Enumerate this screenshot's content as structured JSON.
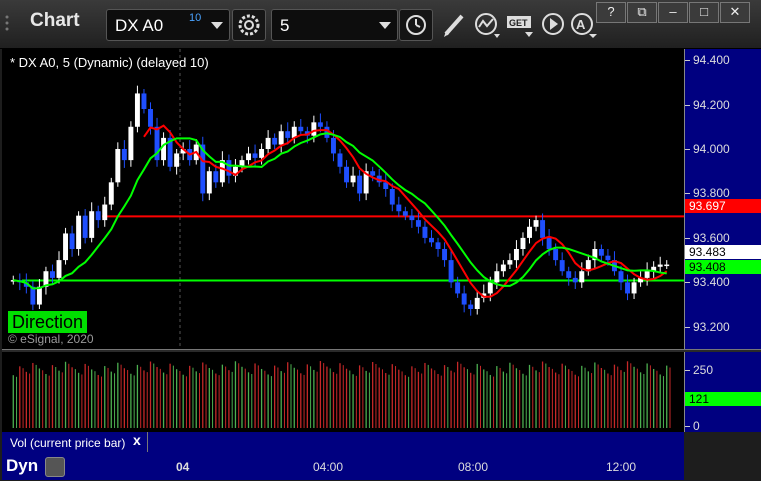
{
  "title_bar": {
    "app_title": "Chart",
    "symbol": "DX A0",
    "symbol_delay": "10",
    "interval": "5"
  },
  "window_buttons": [
    "?",
    "⧉",
    "–",
    "□",
    "✕"
  ],
  "chart": {
    "title": "* DX A0, 5 (Dynamic) (delayed 10)",
    "copyright": "© eSignal, 2020",
    "direction_label": "Direction",
    "price_ticks": [
      "94.400",
      "94.200",
      "94.000",
      "93.800",
      "93.600",
      "93.400",
      "93.200"
    ],
    "tags": [
      {
        "text": "93.697",
        "bg": "#ff0000",
        "fg": "#ffffff"
      },
      {
        "text": "93.483",
        "bg": "#ffffff",
        "fg": "#000000"
      },
      {
        "text": "93.408",
        "bg": "#00ff00",
        "fg": "#000000"
      }
    ],
    "colors": {
      "up_bar": "#ffffff",
      "down_bar": "#1f4fff",
      "red_line": "#ff0000",
      "green_line": "#00ff00",
      "vol_up": "#4caf50",
      "vol_down": "#c62828"
    }
  },
  "volume": {
    "title": "Vol (current price bar)",
    "close_label": "x",
    "ticks": [
      "250",
      "0"
    ],
    "tag": "121"
  },
  "time_axis": {
    "labels": [
      "04",
      "04:00",
      "08:00",
      "12:00"
    ],
    "dyn_label": "Dyn"
  },
  "chart_data": {
    "type": "candlestick",
    "symbol": "DX A0",
    "ylim": [
      93.1,
      94.45
    ],
    "levels": [
      {
        "value": 93.697,
        "color": "#ff0000"
      },
      {
        "value": 93.408,
        "color": "#00ff00"
      }
    ],
    "last_price": 93.483,
    "volume_last": 121,
    "time_labels": [
      "04",
      "04:00",
      "08:00",
      "12:00"
    ],
    "closes": [
      93.41,
      93.4,
      93.38,
      93.3,
      93.38,
      93.45,
      93.42,
      93.5,
      93.62,
      93.55,
      93.7,
      93.6,
      93.72,
      93.68,
      93.75,
      93.85,
      94.0,
      93.95,
      94.1,
      94.25,
      94.18,
      94.1,
      93.95,
      94.05,
      93.92,
      93.98,
      94.0,
      93.95,
      94.02,
      93.8,
      93.9,
      93.85,
      93.95,
      93.88,
      93.92,
      93.95,
      93.98,
      93.96,
      94.0,
      94.05,
      94.02,
      94.08,
      94.05,
      94.1,
      94.08,
      94.06,
      94.12,
      94.1,
      94.05,
      93.98,
      93.92,
      93.85,
      93.88,
      93.8,
      93.9,
      93.88,
      93.85,
      93.82,
      93.75,
      93.72,
      93.7,
      93.68,
      93.65,
      93.6,
      93.58,
      93.55,
      93.5,
      93.4,
      93.35,
      93.3,
      93.28,
      93.33,
      93.35,
      93.4,
      93.45,
      93.48,
      93.5,
      93.55,
      93.6,
      93.65,
      93.68,
      93.6,
      93.55,
      93.5,
      93.45,
      93.42,
      93.4,
      93.45,
      93.5,
      93.55,
      93.52,
      93.5,
      93.45,
      93.4,
      93.35,
      93.4,
      93.42,
      93.45,
      93.47,
      93.48,
      93.48
    ]
  }
}
